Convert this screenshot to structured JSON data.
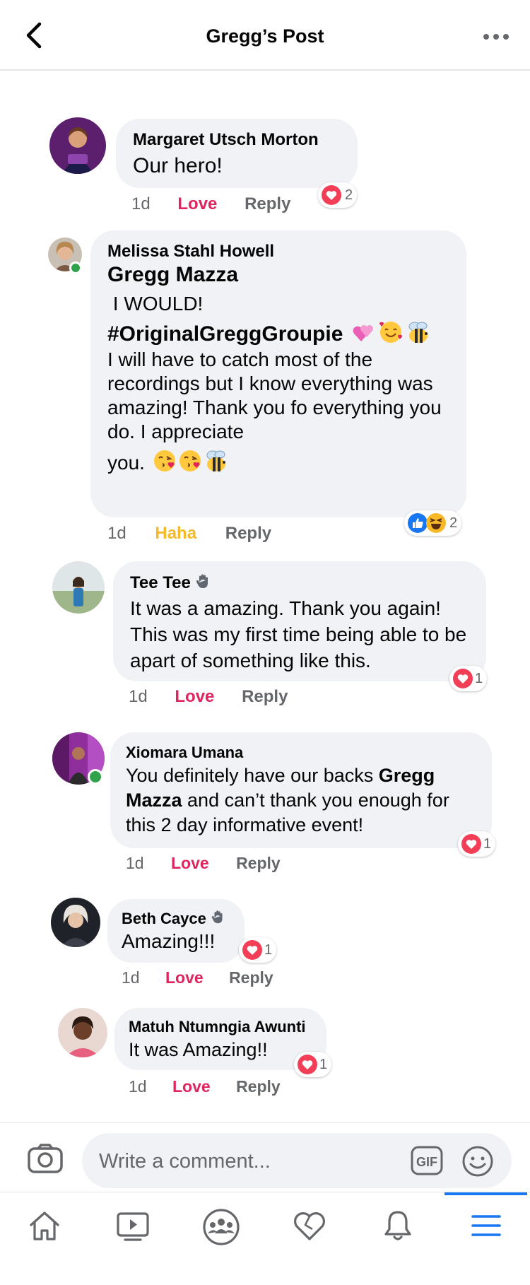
{
  "header": {
    "title": "Gregg’s Post"
  },
  "comments": [
    {
      "name": "Margaret Utsch Morton",
      "text": "Our hero!",
      "time": "1d",
      "reaction_label": "Love",
      "reply": "Reply",
      "reaction_count": "2"
    },
    {
      "name": "Melissa Stahl Howell",
      "mention": "Gregg Mazza",
      "line1": " I WOULD!",
      "hashtag": "#OriginalGreggGroupie",
      "body": "I will have to catch most of the recordings but I know everything was amazing! Thank you fo everything you do. I appreciate",
      "last": "you.",
      "time": "1d",
      "reaction_label": "Haha",
      "reply": "Reply",
      "reaction_count": "2"
    },
    {
      "name": "Tee Tee",
      "text": "It was a amazing. Thank you again! This was my first time  being able to be apart of something like this.",
      "time": "1d",
      "reaction_label": "Love",
      "reply": "Reply",
      "reaction_count": "1"
    },
    {
      "name": "Xiomara Umana",
      "text_a": "You definitely have our backs ",
      "mention_a": "Gregg",
      "mention_b": "Mazza",
      "text_b": " and can’t thank you enough for this 2 day informative event!",
      "time": "1d",
      "reaction_label": "Love",
      "reply": "Reply",
      "reaction_count": "1"
    },
    {
      "name": "Beth Cayce",
      "text": "Amazing!!!",
      "time": "1d",
      "reaction_label": "Love",
      "reply": "Reply",
      "reaction_count": "1"
    },
    {
      "name": "Matuh Ntumngia Awunti",
      "text": "It was Amazing!!",
      "time": "1d",
      "reaction_label": "Love",
      "reply": "Reply",
      "reaction_count": "1"
    }
  ],
  "composer": {
    "placeholder": "Write a comment...",
    "gif_label": "GIF"
  },
  "tabs": [
    "home-icon",
    "watch-icon",
    "groups-icon",
    "dating-icon",
    "notifications-icon",
    "menu-icon"
  ],
  "colors": {
    "love": "#e0245e",
    "haha": "#f7b928",
    "accent": "#1877f2",
    "bubble": "#f0f2f5",
    "secondary_text": "#65676b"
  }
}
